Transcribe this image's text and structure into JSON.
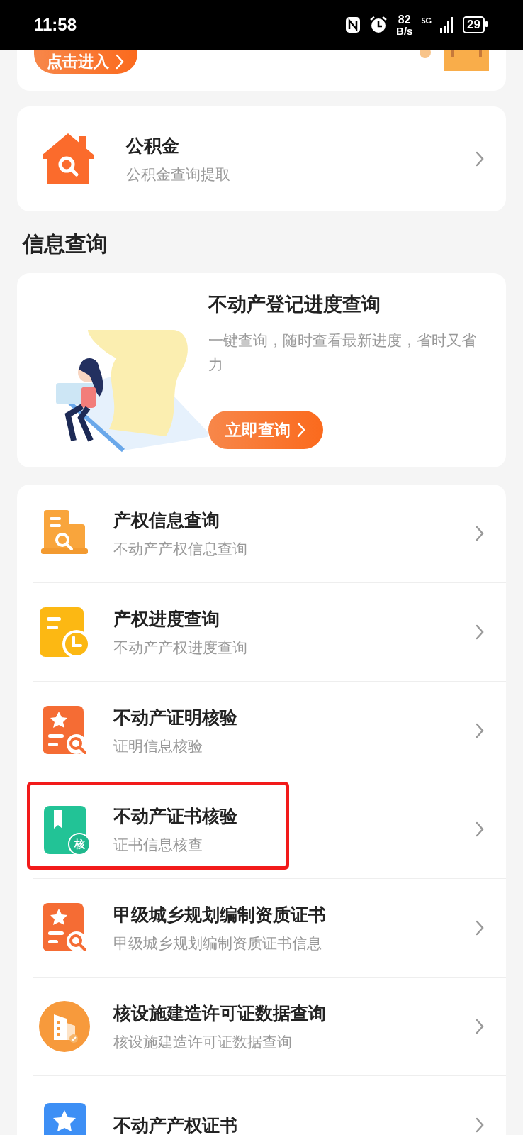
{
  "status_bar": {
    "time": "11:58",
    "net_speed": "82",
    "net_unit": "B/s",
    "network": "5G",
    "battery": "29"
  },
  "top_card": {
    "button": "点击进入"
  },
  "fund_card": {
    "title": "公积金",
    "subtitle": "公积金查询提取"
  },
  "section_title": "信息查询",
  "banner": {
    "title": "不动产登记进度查询",
    "description": "一键查询，随时查看最新进度，省时又省力",
    "button": "立即查询"
  },
  "services": [
    {
      "kind": "doc-search",
      "title": "产权信息查询",
      "subtitle": "不动产产权信息查询",
      "highlighted": false
    },
    {
      "kind": "doc-clock",
      "title": "产权进度查询",
      "subtitle": "不动产产权进度查询",
      "highlighted": false
    },
    {
      "kind": "star-search",
      "title": "不动产证明核验",
      "subtitle": "证明信息核验",
      "highlighted": false
    },
    {
      "kind": "bookmark-badge",
      "badge": "核",
      "title": "不动产证书核验",
      "subtitle": "证书信息核查",
      "highlighted": true
    },
    {
      "kind": "star-search",
      "title": "甲级城乡规划编制资质证书",
      "subtitle": "甲级城乡规划编制资质证书信息",
      "highlighted": false
    },
    {
      "kind": "building",
      "title": "核设施建造许可证数据查询",
      "subtitle": "核设施建造许可证数据查询",
      "highlighted": false
    },
    {
      "kind": "star-blue",
      "title": "不动产产权证书",
      "highlighted": false
    }
  ]
}
